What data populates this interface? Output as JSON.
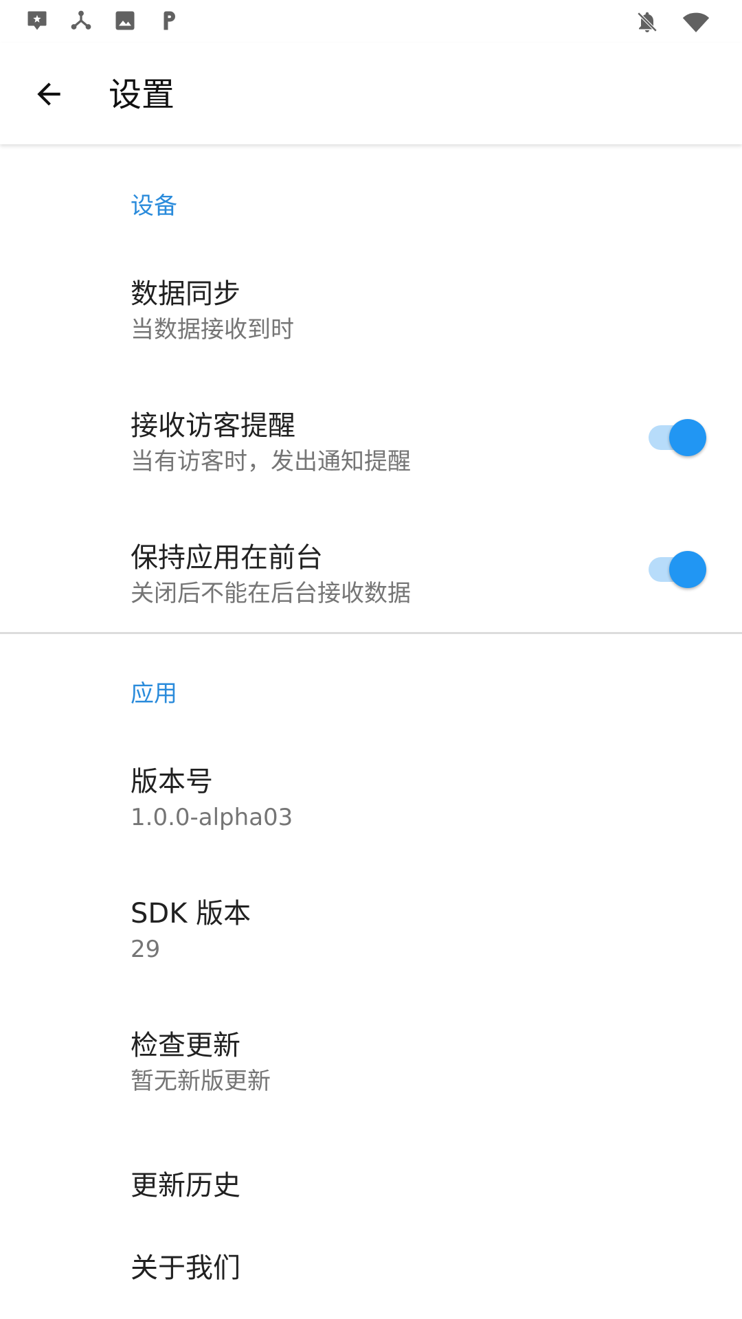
{
  "status_bar": {
    "left_icons": [
      "chat-star-icon",
      "network-icon",
      "image-icon",
      "parking-icon"
    ],
    "right_icons": [
      "notifications-off-icon",
      "wifi-icon"
    ]
  },
  "app_bar": {
    "back_icon": "arrow-back-icon",
    "title": "设置"
  },
  "sections": {
    "device": {
      "header": "设备",
      "data_sync": {
        "title": "数据同步",
        "summary": "当数据接收到时"
      },
      "visitor_alert": {
        "title": "接收访客提醒",
        "summary": "当有访客时，发出通知提醒",
        "enabled": true
      },
      "keep_foreground": {
        "title": "保持应用在前台",
        "summary": "关闭后不能在后台接收数据",
        "enabled": true
      }
    },
    "app": {
      "header": "应用",
      "version": {
        "title": "版本号",
        "summary": "1.0.0-alpha03"
      },
      "sdk_version": {
        "title": "SDK 版本",
        "summary": "29"
      },
      "check_update": {
        "title": "检查更新",
        "summary": "暂无新版更新"
      },
      "update_history": {
        "title": "更新历史"
      },
      "about_us": {
        "title": "关于我们"
      }
    }
  },
  "colors": {
    "accent": "#2196F3",
    "section_header": "#2A8BDB",
    "switch_track": "#B7DCFA",
    "summary_text": "#757575"
  }
}
